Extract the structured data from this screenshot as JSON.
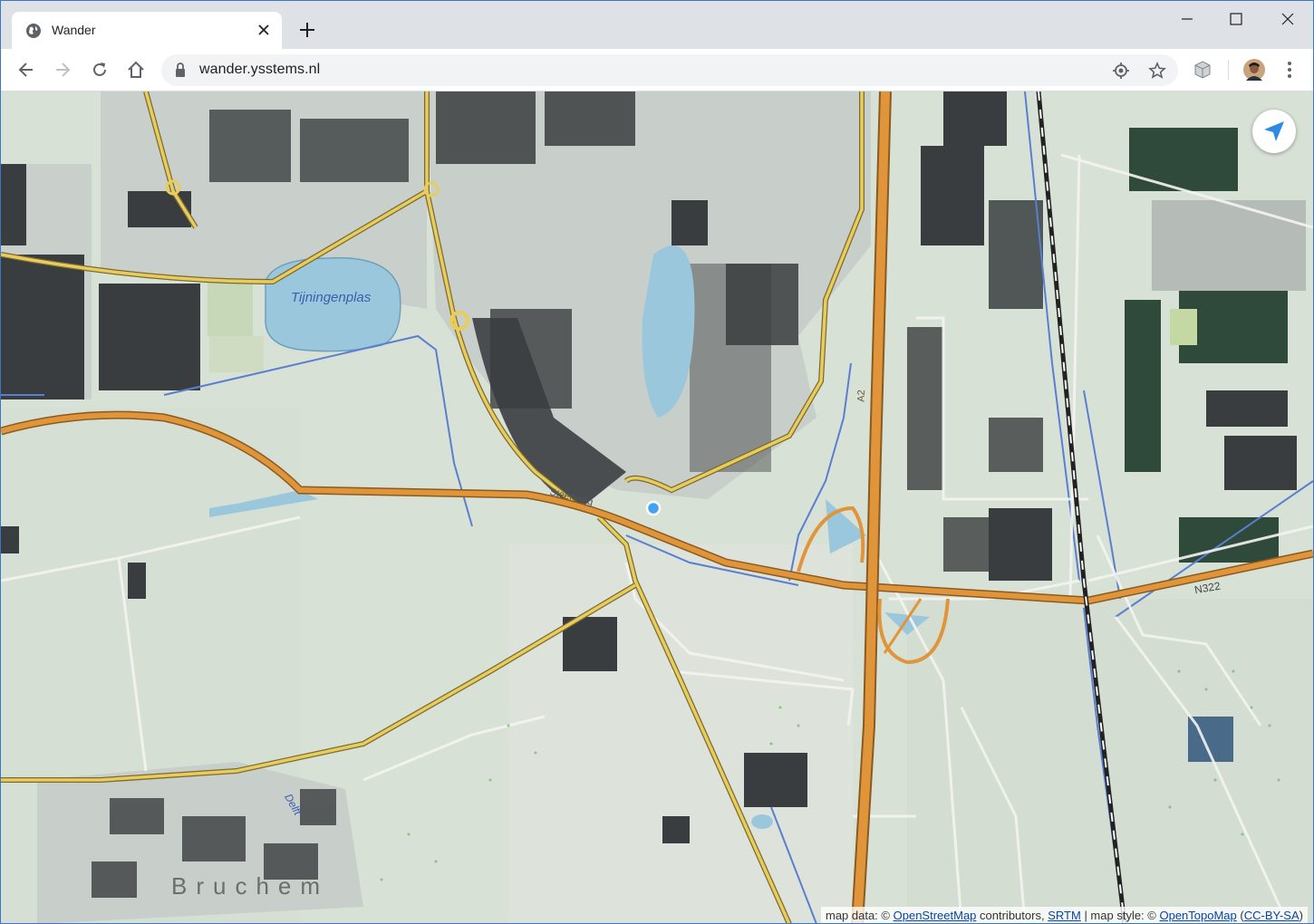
{
  "browser": {
    "tab": {
      "title": "Wander",
      "favicon": "globe-icon",
      "close_icon": "close-icon"
    },
    "new_tab_icon": "plus-icon",
    "window_controls": [
      "minimize-icon",
      "maximize-icon",
      "close-icon"
    ],
    "toolbar": {
      "back_icon": "arrow-left-icon",
      "forward_icon": "arrow-right-icon",
      "reload_icon": "reload-icon",
      "home_icon": "home-icon",
      "url": "wander.ysstems.nl",
      "omnibox_icons": [
        "lock-icon",
        "location-target-icon",
        "star-icon"
      ],
      "extension_icon": "cube-icon",
      "profile_icon": "avatar",
      "menu_icon": "kebab-menu-icon"
    }
  },
  "map": {
    "labels": {
      "lake": "Tijningenplas",
      "road_a2": "A2",
      "road_n322": "N322",
      "street": "Steenweg",
      "town": "Bruchem",
      "water": "Delft"
    },
    "locate_button_icon": "navigation-arrow-icon",
    "attribution": {
      "prefix": "map data: ©",
      "osm": "OpenStreetMap",
      "contrib": "contributors,",
      "srtm": "SRTM",
      "sep": "| map style: ©",
      "otm": "OpenTopoMap",
      "license": "CC-BY-SA"
    },
    "colors": {
      "motorway": "#e0953a",
      "primary": "#e8cd5a",
      "water": "#9bc7dd",
      "land": "#d8e1d6",
      "building": "#3a3d3f"
    }
  }
}
